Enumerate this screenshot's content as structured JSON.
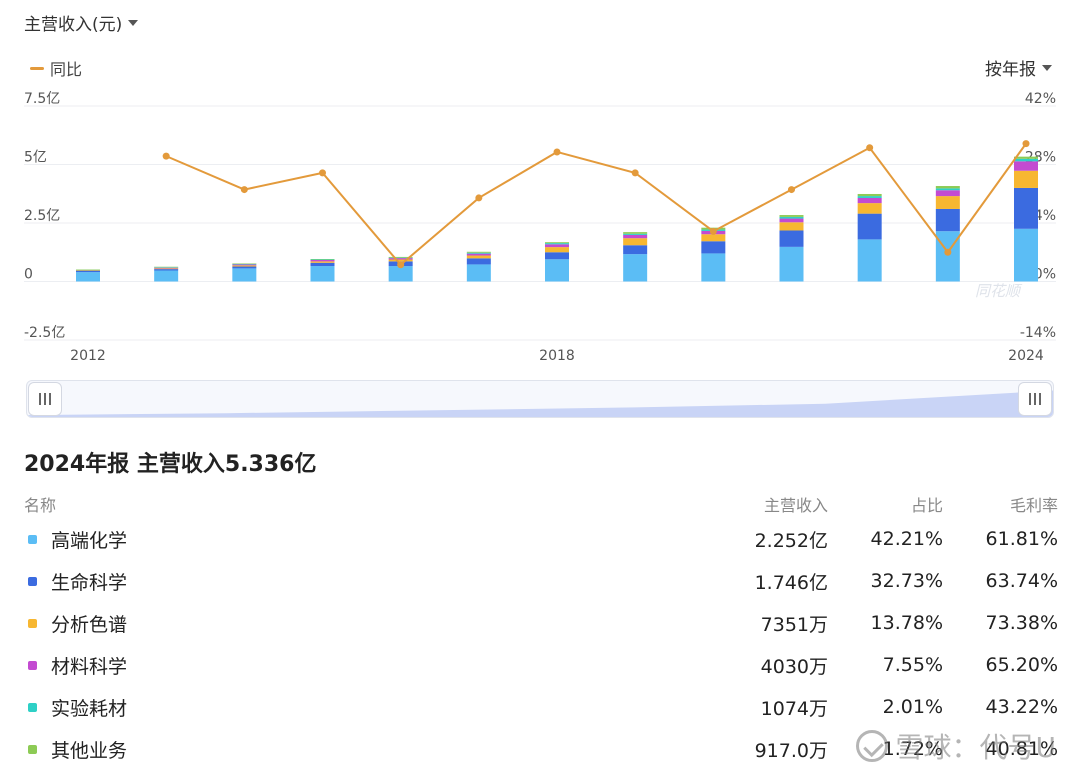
{
  "header": {
    "metric_label": "主营收入(元)",
    "legend_yoy": "同比",
    "period_label": "按年报"
  },
  "colors": {
    "high_end_chemistry": "#5bbdf5",
    "life_science": "#3b6be0",
    "chromatography": "#f7b731",
    "materials_science": "#c34bd1",
    "lab_consumables": "#2ed0c6",
    "other": "#8dcb55",
    "yoy_line": "#e39a3b",
    "slider_fill": "#c9d4f6"
  },
  "chart_data": {
    "type": "bar",
    "stacked": true,
    "categories": [
      "2012",
      "2013",
      "2014",
      "2015",
      "2016",
      "2017",
      "2018",
      "2019",
      "2020",
      "2021",
      "2022",
      "2023",
      "2024"
    ],
    "x_tick_labels": [
      {
        "index": 0,
        "label": "2012"
      },
      {
        "index": 6,
        "label": "2018"
      },
      {
        "index": 12,
        "label": "2024"
      }
    ],
    "y_left": {
      "ticks": [
        "7.5亿",
        "5亿",
        "2.5亿",
        "0",
        "-2.5亿"
      ],
      "tick_values": [
        7.5,
        5,
        2.5,
        0,
        -2.5
      ],
      "unit": "亿",
      "ylim": [
        -2.5,
        7.5
      ]
    },
    "y_right": {
      "ticks": [
        "42%",
        "28%",
        "14%",
        "0%",
        "-14%"
      ],
      "tick_values": [
        42,
        28,
        14,
        0,
        -14
      ],
      "ylim": [
        -14,
        42
      ]
    },
    "series": [
      {
        "name": "高端化学",
        "values": [
          0.4,
          0.47,
          0.56,
          0.66,
          0.66,
          0.73,
          0.95,
          1.17,
          1.2,
          1.48,
          1.8,
          2.15,
          2.252
        ]
      },
      {
        "name": "生命科学",
        "values": [
          0.05,
          0.06,
          0.08,
          0.14,
          0.2,
          0.26,
          0.3,
          0.38,
          0.52,
          0.7,
          1.1,
          0.95,
          1.746
        ]
      },
      {
        "name": "分析色谱",
        "values": [
          0.02,
          0.03,
          0.05,
          0.06,
          0.08,
          0.12,
          0.22,
          0.3,
          0.3,
          0.35,
          0.45,
          0.55,
          0.7351
        ]
      },
      {
        "name": "材料科学",
        "values": [
          0.02,
          0.03,
          0.04,
          0.06,
          0.06,
          0.08,
          0.12,
          0.14,
          0.14,
          0.16,
          0.22,
          0.25,
          0.403
        ]
      },
      {
        "name": "实验耗材",
        "values": [
          0.01,
          0.02,
          0.02,
          0.02,
          0.02,
          0.04,
          0.05,
          0.05,
          0.06,
          0.07,
          0.08,
          0.08,
          0.1074
        ]
      },
      {
        "name": "其他业务",
        "values": [
          0.01,
          0.02,
          0.02,
          0.02,
          0.03,
          0.04,
          0.04,
          0.07,
          0.08,
          0.08,
          0.09,
          0.1,
          0.0917
        ]
      }
    ],
    "yoy": {
      "name": "同比",
      "x_start_index": 1,
      "values": [
        30,
        22,
        26,
        4,
        20,
        31,
        26,
        12,
        22,
        32,
        7,
        33
      ]
    },
    "watermark": "同花顺",
    "grid": true
  },
  "detail": {
    "title": "2024年报 主营收入5.336亿",
    "columns": [
      "名称",
      "主营收入",
      "占比",
      "毛利率"
    ],
    "rows": [
      {
        "name": "高端化学",
        "revenue": "2.252亿",
        "share": "42.21%",
        "margin": "61.81%",
        "color": "#5bbdf5"
      },
      {
        "name": "生命科学",
        "revenue": "1.746亿",
        "share": "32.73%",
        "margin": "63.74%",
        "color": "#3b6be0"
      },
      {
        "name": "分析色谱",
        "revenue": "7351万",
        "share": "13.78%",
        "margin": "73.38%",
        "color": "#f7b731"
      },
      {
        "name": "材料科学",
        "revenue": "4030万",
        "share": "7.55%",
        "margin": "65.20%",
        "color": "#c34bd1"
      },
      {
        "name": "实验耗材",
        "revenue": "1074万",
        "share": "2.01%",
        "margin": "43.22%",
        "color": "#2ed0c6"
      },
      {
        "name": "其他业务",
        "revenue": "917.0万",
        "share": "1.72%",
        "margin": "40.81%",
        "color": "#8dcb55"
      }
    ]
  },
  "watermark": {
    "text": "雪球：代号U",
    "icon": "snowball-logo-icon"
  }
}
